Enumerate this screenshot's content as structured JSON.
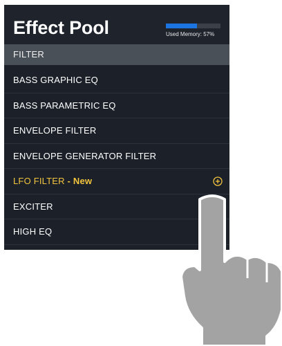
{
  "header": {
    "title": "Effect Pool",
    "memory_label": "Used Memory: 57%",
    "memory_used_percent": 57
  },
  "section": {
    "label": "FILTER"
  },
  "items": [
    {
      "label": "BASS GRAPHIC EQ"
    },
    {
      "label": "BASS PARAMETRIC EQ"
    },
    {
      "label": "ENVELOPE FILTER"
    },
    {
      "label": "ENVELOPE GENERATOR FILTER"
    },
    {
      "label": "LFO FILTER",
      "tag": " - New",
      "action_icon": "add-circle-icon"
    },
    {
      "label": "EXCITER"
    },
    {
      "label": "HIGH EQ"
    }
  ],
  "colors": {
    "panel_bg": "#1b2029",
    "section_bg": "#4a5058",
    "highlight": "#f3c43e",
    "memory_fill": "#1c74e0",
    "hand": "#a3a3a3"
  },
  "overlay": {
    "icon": "pointing-hand-icon"
  }
}
